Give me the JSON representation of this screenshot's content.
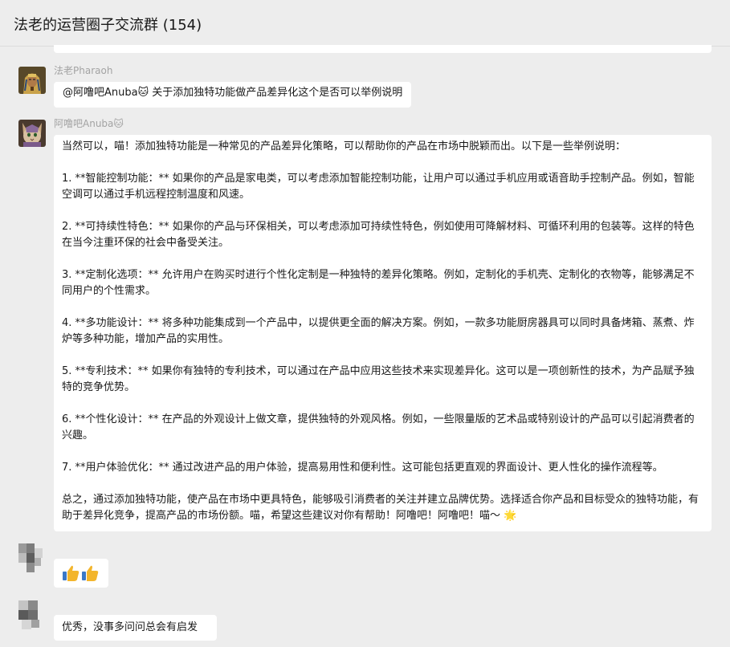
{
  "header": {
    "title": "法老的运营圈子交流群 (154)"
  },
  "messages": [
    {
      "sender": "法老Pharaoh",
      "text": "@阿噜吧Anuba🐱 关于添加独特功能做产品差异化这个是否可以举例说明"
    },
    {
      "sender": "阿噜吧Anuba🐱",
      "paragraphs": [
        "当然可以，喵！添加独特功能是一种常见的产品差异化策略，可以帮助你的产品在市场中脱颖而出。以下是一些举例说明：",
        "1. **智能控制功能：** 如果你的产品是家电类，可以考虑添加智能控制功能，让用户可以通过手机应用或语音助手控制产品。例如，智能空调可以通过手机远程控制温度和风速。",
        "2. **可持续性特色：** 如果你的产品与环保相关，可以考虑添加可持续性特色，例如使用可降解材料、可循环利用的包装等。这样的特色在当今注重环保的社会中备受关注。",
        "3. **定制化选项：** 允许用户在购买时进行个性化定制是一种独特的差异化策略。例如，定制化的手机壳、定制化的衣物等，能够满足不同用户的个性需求。",
        "4. **多功能设计：** 将多种功能集成到一个产品中，以提供更全面的解决方案。例如，一款多功能厨房器具可以同时具备烤箱、蒸煮、炸炉等多种功能，增加产品的实用性。",
        "5. **专利技术：** 如果你有独特的专利技术，可以通过在产品中应用这些技术来实现差异化。这可以是一项创新性的技术，为产品赋予独特的竞争优势。",
        "6. **个性化设计：** 在产品的外观设计上做文章，提供独特的外观风格。例如，一些限量版的艺术品或特别设计的产品可以引起消费者的兴趣。",
        "7. **用户体验优化：** 通过改进产品的用户体验，提高易用性和便利性。这可能包括更直观的界面设计、更人性化的操作流程等。",
        "总之，通过添加独特功能，使产品在市场中更具特色，能够吸引消费者的关注并建立品牌优势。选择适合你产品和目标受众的独特功能，有助于差异化竞争，提高产品的市场份额。喵，希望这些建议对你有帮助！阿噜吧！阿噜吧！喵～ 🌟"
      ]
    },
    {
      "sender": "",
      "text": "👍👍"
    },
    {
      "sender": "",
      "text": "优秀，没事多问问总会有启发"
    }
  ],
  "colors": {
    "background": "#ededed",
    "bubble": "#ffffff",
    "sender_name": "#a3a3a3",
    "text": "#191919"
  },
  "icons": {
    "thumbs_up": "thumbs-up-icon",
    "star": "star-icon",
    "cat": "cat-face-icon"
  }
}
